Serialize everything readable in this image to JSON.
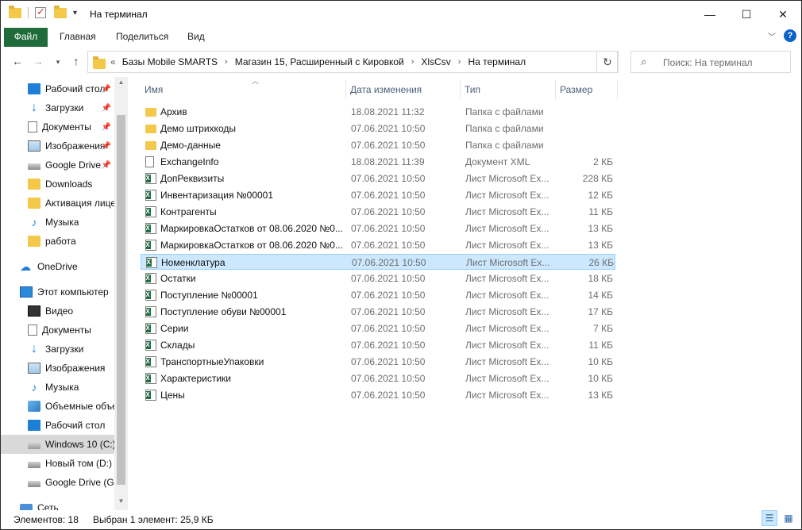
{
  "window": {
    "title": "На терминал"
  },
  "ribbon": {
    "tabs": [
      {
        "label": "Файл"
      },
      {
        "label": "Главная"
      },
      {
        "label": "Поделиться"
      },
      {
        "label": "Вид"
      }
    ],
    "help": "?"
  },
  "address": {
    "overflow": "«",
    "crumbs": [
      "Базы Mobile SMARTS",
      "Магазин 15, Расширенный с Кировкой",
      "XlsCsv",
      "На терминал"
    ]
  },
  "search": {
    "placeholder": "Поиск: На терминал"
  },
  "sidebar": {
    "items": [
      {
        "label": "Рабочий стол",
        "icon": "desktop-icon",
        "pinned": true
      },
      {
        "label": "Загрузки",
        "icon": "downloads-icon",
        "pinned": true
      },
      {
        "label": "Документы",
        "icon": "documents-icon",
        "pinned": true
      },
      {
        "label": "Изображения",
        "icon": "pictures-icon",
        "pinned": true
      },
      {
        "label": "Google Drive",
        "icon": "drive-icon",
        "pinned": true
      },
      {
        "label": "Downloads",
        "icon": "folder-icon",
        "pinned": false
      },
      {
        "label": "Активация лицензии",
        "icon": "folder-icon",
        "pinned": false
      },
      {
        "label": "Музыка",
        "icon": "music-icon",
        "pinned": false
      },
      {
        "label": "работа",
        "icon": "folder-icon",
        "pinned": false
      },
      {
        "label": "OneDrive",
        "icon": "onedrive-icon",
        "pinned": false
      },
      {
        "label": "Этот компьютер",
        "icon": "computer-icon",
        "pinned": false
      },
      {
        "label": "Видео",
        "icon": "video-icon",
        "pinned": false
      },
      {
        "label": "Документы",
        "icon": "documents-icon",
        "pinned": false
      },
      {
        "label": "Загрузки",
        "icon": "downloads-icon",
        "pinned": false
      },
      {
        "label": "Изображения",
        "icon": "pictures-icon",
        "pinned": false
      },
      {
        "label": "Музыка",
        "icon": "music-icon",
        "pinned": false
      },
      {
        "label": "Объемные объекты",
        "icon": "3d-objects-icon",
        "pinned": false
      },
      {
        "label": "Рабочий стол",
        "icon": "desktop-icon",
        "pinned": false
      },
      {
        "label": "Windows 10 (C:)",
        "icon": "windows-drive-icon",
        "pinned": false
      },
      {
        "label": "Новый том (D:)",
        "icon": "drive-icon",
        "pinned": false
      },
      {
        "label": "Google Drive (G:)",
        "icon": "drive-icon",
        "pinned": false
      },
      {
        "label": "Сеть",
        "icon": "network-icon",
        "pinned": false
      }
    ]
  },
  "columns": {
    "name": "Имя",
    "date": "Дата изменения",
    "type": "Тип",
    "size": "Размер"
  },
  "files": [
    {
      "name": "Архив",
      "date": "18.08.2021 11:32",
      "type": "Папка с файлами",
      "size": "",
      "kind": "folder"
    },
    {
      "name": "Демо штрихкоды",
      "date": "07.06.2021 10:50",
      "type": "Папка с файлами",
      "size": "",
      "kind": "folder"
    },
    {
      "name": "Демо-данные",
      "date": "07.06.2021 10:50",
      "type": "Папка с файлами",
      "size": "",
      "kind": "folder"
    },
    {
      "name": "ExchangeInfo",
      "date": "18.08.2021 11:39",
      "type": "Документ XML",
      "size": "2 КБ",
      "kind": "xml"
    },
    {
      "name": "ДопРеквизиты",
      "date": "07.06.2021 10:50",
      "type": "Лист Microsoft Ex...",
      "size": "228 КБ",
      "kind": "xls"
    },
    {
      "name": "Инвентаризация №00001",
      "date": "07.06.2021 10:50",
      "type": "Лист Microsoft Ex...",
      "size": "12 КБ",
      "kind": "xls"
    },
    {
      "name": "Контрагенты",
      "date": "07.06.2021 10:50",
      "type": "Лист Microsoft Ex...",
      "size": "11 КБ",
      "kind": "xls"
    },
    {
      "name": "МаркировкаОстатков от 08.06.2020 №0...",
      "date": "07.06.2021 10:50",
      "type": "Лист Microsoft Ex...",
      "size": "13 КБ",
      "kind": "xls"
    },
    {
      "name": "МаркировкаОстатков от 08.06.2020 №0...",
      "date": "07.06.2021 10:50",
      "type": "Лист Microsoft Ex...",
      "size": "13 КБ",
      "kind": "xls"
    },
    {
      "name": "Номенклатура",
      "date": "07.06.2021 10:50",
      "type": "Лист Microsoft Ex...",
      "size": "26 КБ",
      "kind": "xls",
      "selected": true
    },
    {
      "name": "Остатки",
      "date": "07.06.2021 10:50",
      "type": "Лист Microsoft Ex...",
      "size": "18 КБ",
      "kind": "xls"
    },
    {
      "name": "Поступление №00001",
      "date": "07.06.2021 10:50",
      "type": "Лист Microsoft Ex...",
      "size": "14 КБ",
      "kind": "xls"
    },
    {
      "name": "Поступление обуви №00001",
      "date": "07.06.2021 10:50",
      "type": "Лист Microsoft Ex...",
      "size": "17 КБ",
      "kind": "xls"
    },
    {
      "name": "Серии",
      "date": "07.06.2021 10:50",
      "type": "Лист Microsoft Ex...",
      "size": "7 КБ",
      "kind": "xls"
    },
    {
      "name": "Склады",
      "date": "07.06.2021 10:50",
      "type": "Лист Microsoft Ex...",
      "size": "11 КБ",
      "kind": "xls"
    },
    {
      "name": "ТранспортныеУпаковки",
      "date": "07.06.2021 10:50",
      "type": "Лист Microsoft Ex...",
      "size": "10 КБ",
      "kind": "xls"
    },
    {
      "name": "Характеристики",
      "date": "07.06.2021 10:50",
      "type": "Лист Microsoft Ex...",
      "size": "10 КБ",
      "kind": "xls"
    },
    {
      "name": "Цены",
      "date": "07.06.2021 10:50",
      "type": "Лист Microsoft Ex...",
      "size": "13 КБ",
      "kind": "xls"
    }
  ],
  "status": {
    "count": "Элементов: 18",
    "selection": "Выбран 1 элемент: 25,9 КБ"
  }
}
